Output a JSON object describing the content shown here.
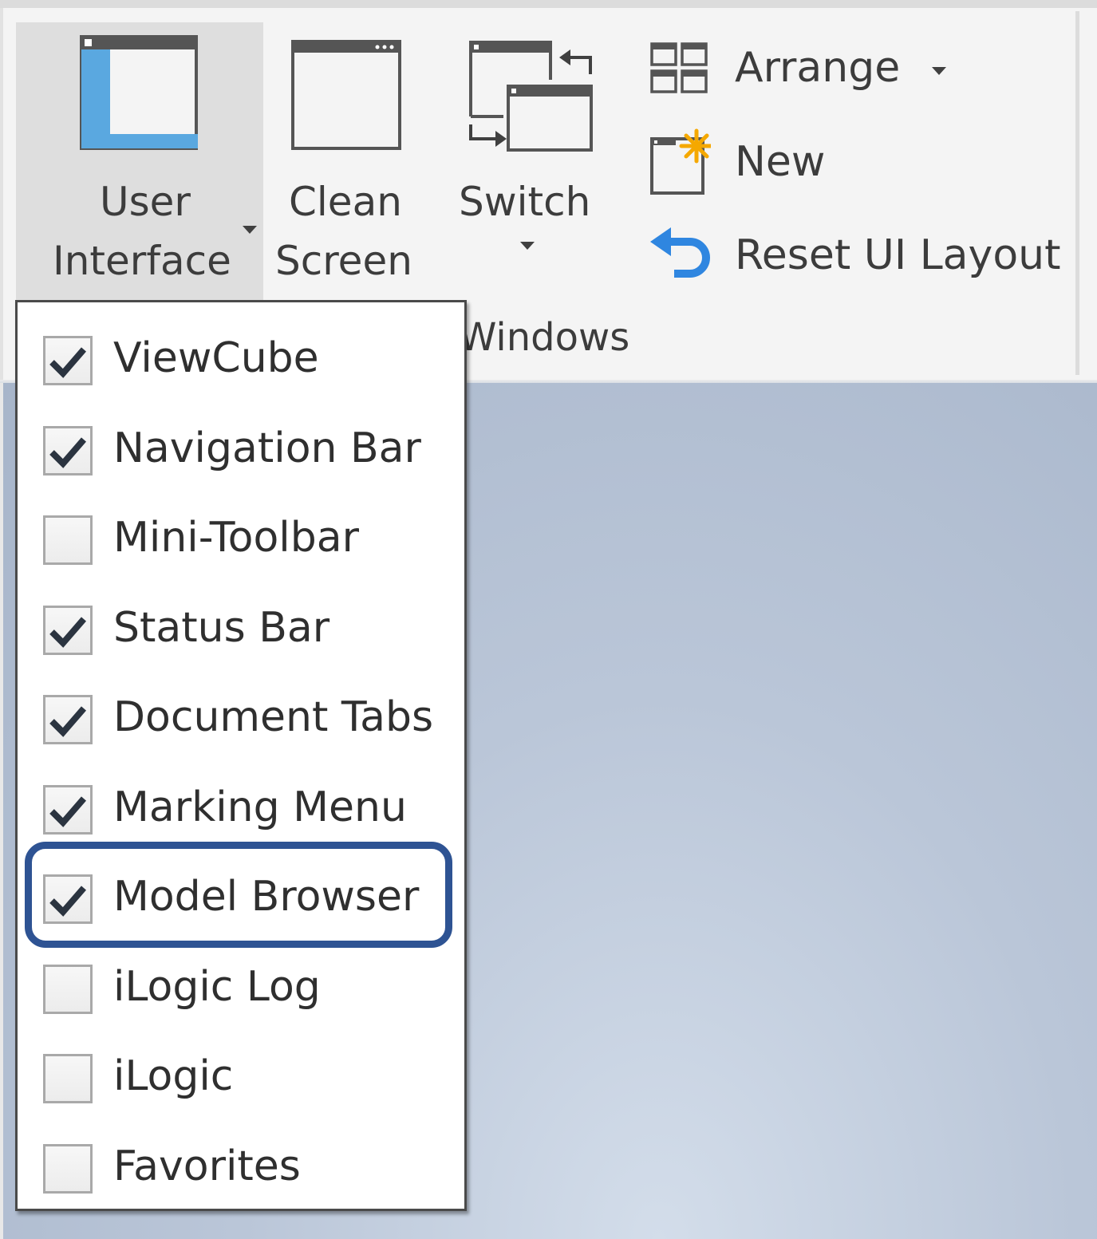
{
  "ribbon": {
    "buttons": [
      {
        "id": "user-interface",
        "label_line1": "User",
        "label_line2": "Interface",
        "has_dropdown": true,
        "active": true,
        "icon": "user-interface-window-icon"
      },
      {
        "id": "clean-screen",
        "label_line1": "Clean",
        "label_line2": "Screen",
        "has_dropdown": false,
        "icon": "clean-screen-window-icon"
      },
      {
        "id": "switch",
        "label_line1": "Switch",
        "has_dropdown": true,
        "icon": "switch-windows-icon"
      }
    ],
    "small_buttons": [
      {
        "id": "arrange",
        "label": "Arrange",
        "has_dropdown": true,
        "icon": "arrange-tiles-icon"
      },
      {
        "id": "new",
        "label": "New",
        "icon": "new-window-icon"
      },
      {
        "id": "reset-ui-layout",
        "label": "Reset UI Layout",
        "icon": "reset-undo-arrow-icon"
      }
    ],
    "panel_title": "Windows"
  },
  "colors": {
    "accent_blue": "#5aa8e0",
    "new_star": "#f5a800",
    "reset_arrow": "#2f86e0",
    "highlight_border": "#2e5393"
  },
  "menu": {
    "items": [
      {
        "label": "ViewCube",
        "checked": true
      },
      {
        "label": "Navigation Bar",
        "checked": true
      },
      {
        "label": "Mini-Toolbar",
        "checked": false
      },
      {
        "label": "Status Bar",
        "checked": true
      },
      {
        "label": "Document Tabs",
        "checked": true
      },
      {
        "label": "Marking Menu",
        "checked": true
      },
      {
        "label": "Model Browser",
        "checked": true,
        "highlighted": true
      },
      {
        "label": "iLogic Log",
        "checked": false
      },
      {
        "label": "iLogic",
        "checked": false
      },
      {
        "label": "Favorites",
        "checked": false
      }
    ]
  }
}
